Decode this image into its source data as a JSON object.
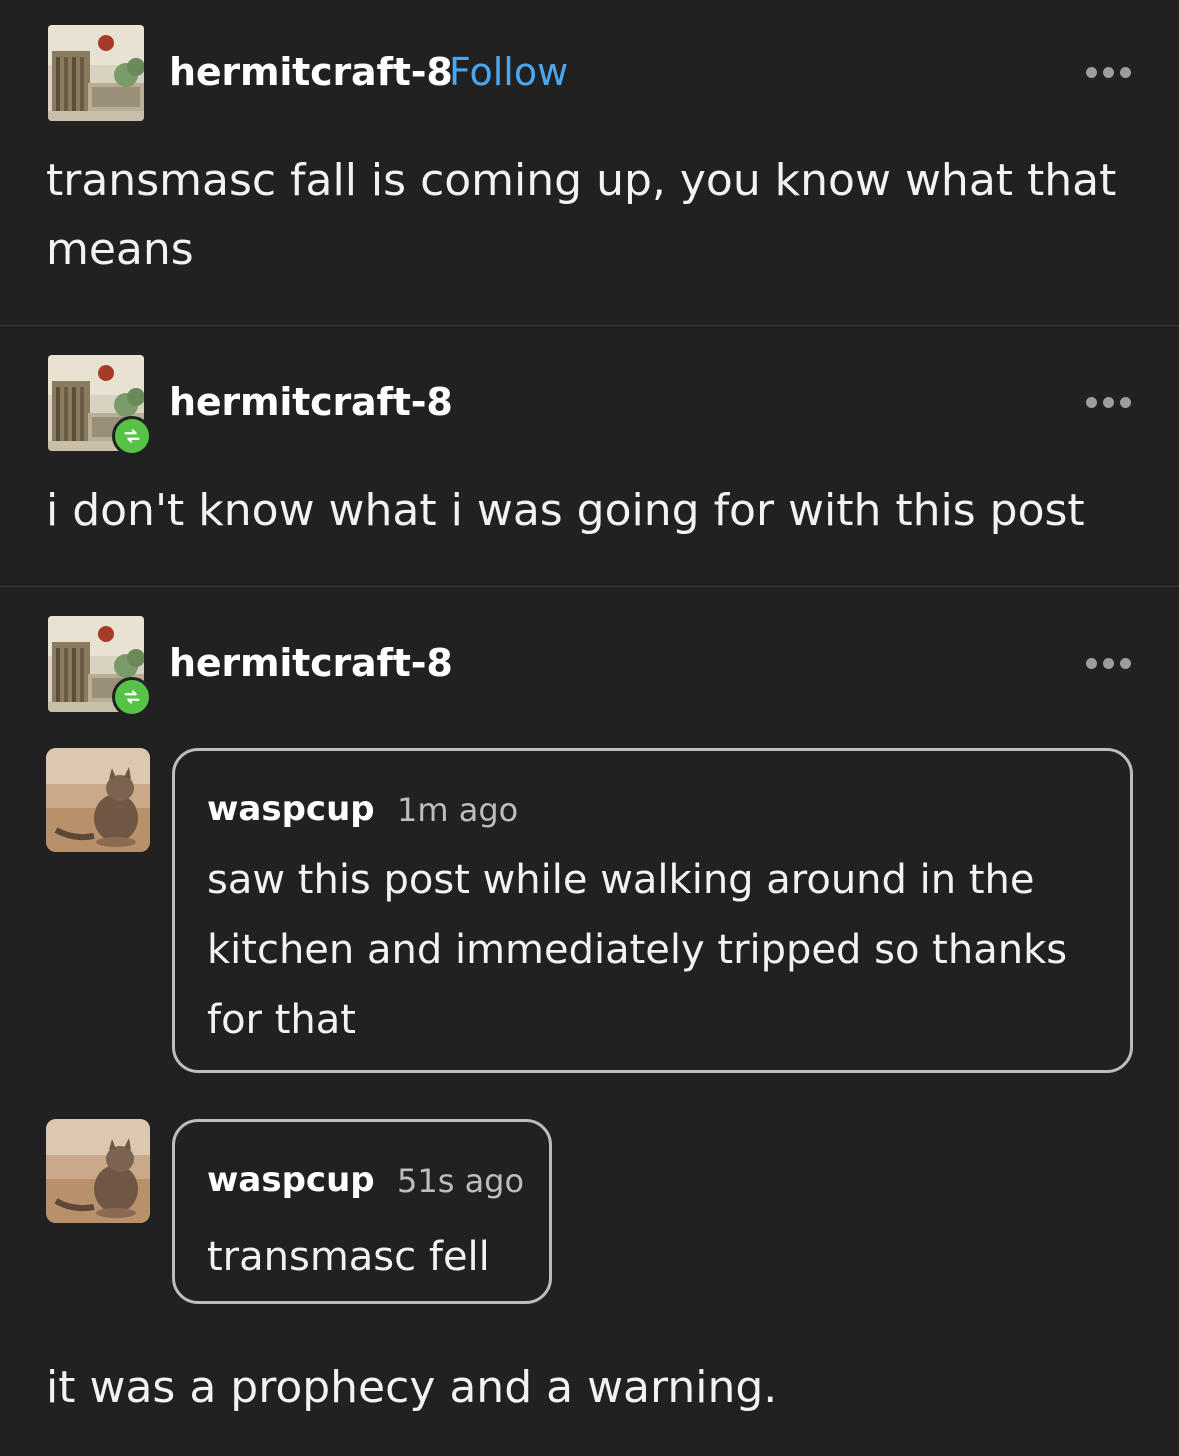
{
  "posts": [
    {
      "username": "hermitcraft-8",
      "follow_label": "Follow",
      "avatar_icon": "hermitcraft-avatar",
      "more_icon": "more-options-icon",
      "text": "transmasc fall is coming up, you know what that means"
    },
    {
      "username": "hermitcraft-8",
      "reblog_icon": "reblog-icon",
      "more_icon": "more-options-icon",
      "text": "i don't know what i was going for with this post"
    },
    {
      "username": "hermitcraft-8",
      "reblog_icon": "reblog-icon",
      "more_icon": "more-options-icon",
      "replies": [
        {
          "username": "waspcup",
          "time": "1m ago",
          "text": "saw this post while walking around in the kitchen and immediately tripped so thanks for that",
          "avatar_icon": "cat-avatar"
        },
        {
          "username": "waspcup",
          "time": "51s ago",
          "text": "transmasc fell",
          "avatar_icon": "cat-avatar"
        }
      ],
      "text": "it was a prophecy and a warning."
    }
  ],
  "colors": {
    "background": "#212122",
    "follow_link": "#4aa7f0",
    "reblog_badge": "#56c346",
    "bubble_border": "#bdbdbf"
  }
}
